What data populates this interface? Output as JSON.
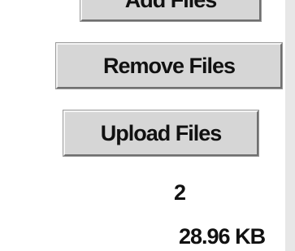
{
  "buttons": {
    "top_label": "Add Files",
    "remove_label": "Remove Files",
    "upload_label": "Upload Files"
  },
  "summary": {
    "file_count": "2",
    "total_size": "28.96 KB"
  }
}
